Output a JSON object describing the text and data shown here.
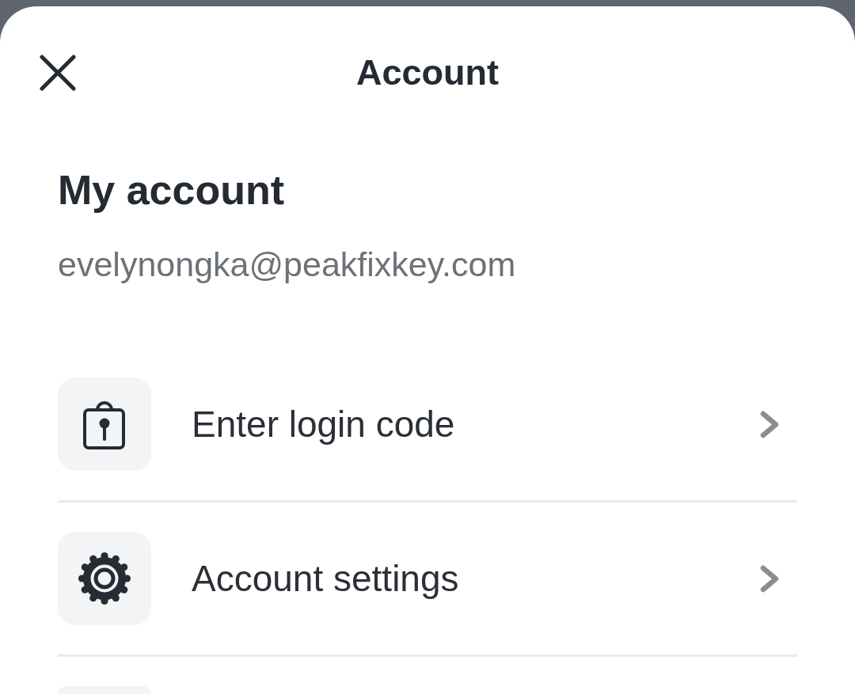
{
  "header": {
    "title": "Account"
  },
  "account": {
    "heading": "My account",
    "email": "evelynongka@peakfixkey.com"
  },
  "menu": [
    {
      "kind": "login_code",
      "label": "Enter login code"
    },
    {
      "kind": "settings",
      "label": "Account settings"
    },
    {
      "kind": "cut_off"
    }
  ]
}
